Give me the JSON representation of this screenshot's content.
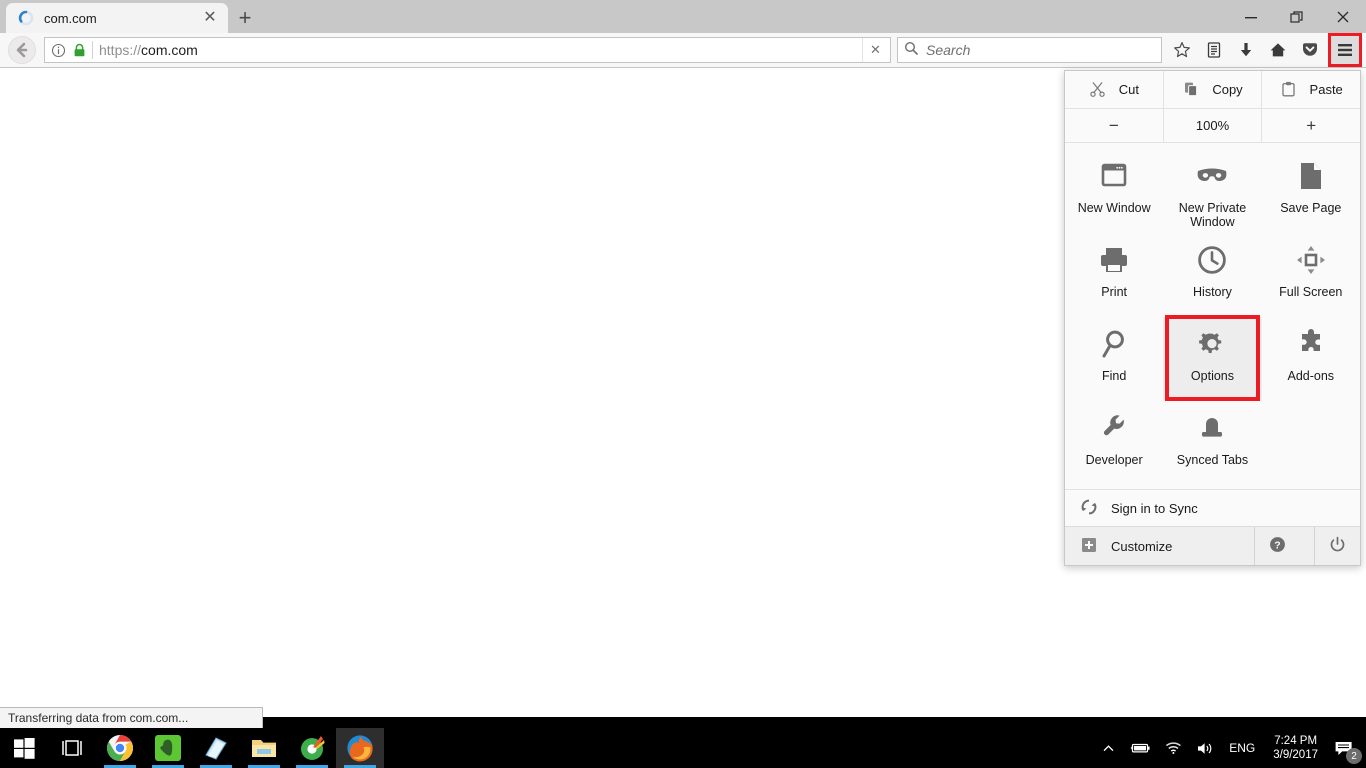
{
  "window": {
    "minimize_label": "Minimize",
    "restore_label": "Restore",
    "close_label": "Close"
  },
  "tabs": {
    "active_tab_title": "com.com",
    "close_tab_label": "✕",
    "new_tab_label": "+"
  },
  "navbar": {
    "url_scheme": "https://",
    "url_host": "com.com",
    "url_clear_label": "✕",
    "search_placeholder": "Search",
    "icons": [
      "bookmark-star-icon",
      "reader-list-icon",
      "downloads-icon",
      "home-icon",
      "pocket-icon",
      "hamburger-menu-icon"
    ]
  },
  "panel": {
    "clipboard": [
      {
        "label": "Cut",
        "icon": "scissors-icon"
      },
      {
        "label": "Copy",
        "icon": "copy-icon"
      },
      {
        "label": "Paste",
        "icon": "clipboard-icon"
      }
    ],
    "zoom": {
      "minus_label": "−",
      "level": "100%",
      "plus_label": "+"
    },
    "items": [
      {
        "label": "New Window",
        "icon": "new-window-icon",
        "highlighted": false
      },
      {
        "label": "New Private Window",
        "icon": "private-mask-icon",
        "highlighted": false
      },
      {
        "label": "Save Page",
        "icon": "page-icon",
        "highlighted": false
      },
      {
        "label": "Print",
        "icon": "printer-icon",
        "highlighted": false
      },
      {
        "label": "History",
        "icon": "clock-icon",
        "highlighted": false
      },
      {
        "label": "Full Screen",
        "icon": "fullscreen-icon",
        "highlighted": false
      },
      {
        "label": "Find",
        "icon": "magnifier-icon",
        "highlighted": false
      },
      {
        "label": "Options",
        "icon": "gear-icon",
        "highlighted": true
      },
      {
        "label": "Add-ons",
        "icon": "puzzle-icon",
        "highlighted": false
      },
      {
        "label": "Developer",
        "icon": "wrench-icon",
        "highlighted": false
      },
      {
        "label": "Synced Tabs",
        "icon": "synced-tabs-icon",
        "highlighted": false
      }
    ],
    "sync": {
      "label": "Sign in to Sync",
      "icon": "sync-arrows-icon"
    },
    "customize": {
      "label": "Customize",
      "icon": "plus-box-icon"
    },
    "help": {
      "icon": "help-circle-icon"
    },
    "power": {
      "icon": "power-icon"
    },
    "highlight_color": "#ed1c24"
  },
  "statusbar": {
    "text": "Transferring data from com.com..."
  },
  "taskbar": {
    "apps": [
      {
        "name": "start-button",
        "icon": "windows-logo-icon"
      },
      {
        "name": "task-view-button",
        "icon": "task-view-icon"
      },
      {
        "name": "taskbar-chrome",
        "icon": "chrome-icon"
      },
      {
        "name": "taskbar-evernote",
        "icon": "evernote-icon"
      },
      {
        "name": "taskbar-sticky-notes",
        "icon": "sticky-notes-icon"
      },
      {
        "name": "taskbar-file-explorer",
        "icon": "folder-icon"
      },
      {
        "name": "taskbar-media-app",
        "icon": "green-disc-icon"
      },
      {
        "name": "taskbar-firefox",
        "icon": "firefox-icon"
      }
    ],
    "tray": {
      "chevron": "∧",
      "battery_icon": "battery-icon",
      "wifi_icon": "wifi-icon",
      "volume_icon": "volume-icon",
      "language": "ENG",
      "time": "7:24 PM",
      "date": "3/9/2017",
      "notification_count": "2"
    }
  }
}
